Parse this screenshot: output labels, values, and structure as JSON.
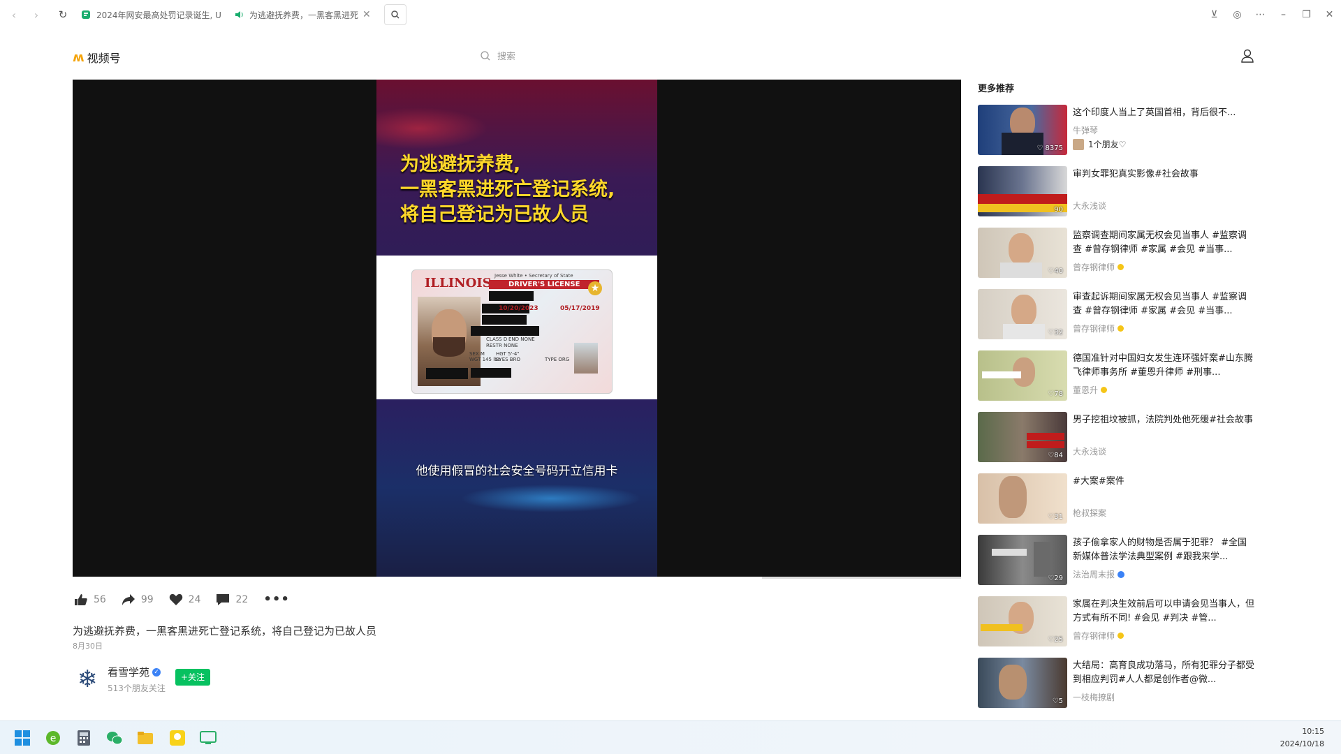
{
  "browser": {
    "tabs": [
      {
        "label": "2024年网安最高处罚记录诞生, U"
      },
      {
        "label": "为逃避抚养费，一黑客黑进死"
      }
    ]
  },
  "app": {
    "logo_text": "视频号",
    "search_placeholder": "搜索"
  },
  "video": {
    "headline": [
      "为逃避抚养费,",
      "一黑客黑进死亡登记系统,",
      "将自己登记为已故人员"
    ],
    "subtitle": "他使用假冒的社会安全号码开立信用卡",
    "card": {
      "state": "ILLINOIS",
      "type": "DRIVER'S LICENSE",
      "secretary": "Jesse White • Secretary of State",
      "issue_date": "10/20/2023",
      "exp_date": "05/17/2019",
      "class": "D",
      "restr": "NONE",
      "end": "NONE",
      "sex": "M",
      "height": "5'-4\"",
      "weight": "145 lbs",
      "eyes": "BRO",
      "type_code": "ORG"
    }
  },
  "actions": {
    "like": "56",
    "share": "99",
    "favorite": "24",
    "comment": "22"
  },
  "post": {
    "description": "为逃避抚养费，一黑客黑进死亡登记系统，将自己登记为已故人员",
    "date": "8月30日",
    "author": "看雪学苑",
    "fans": "513个朋友关注",
    "follow_label": "+关注"
  },
  "recommend": {
    "title": "更多推荐",
    "items": [
      {
        "title": "这个印度人当上了英国首相，背后很不...",
        "author": "牛弹琴",
        "likes": "8375",
        "friends": "1个朋友♡"
      },
      {
        "title": "审判女罪犯真实影像#社会故事",
        "author": "大永浅谈",
        "likes": "90"
      },
      {
        "title": "监察调查期间家属无权会见当事人 #监察调查 #曾存钢律师 #家属 #会见 #当事...",
        "author": "曾存钢律师",
        "likes": "40"
      },
      {
        "title": "审查起诉期间家属无权会见当事人 #监察调查 #曾存钢律师 #家属 #会见 #当事...",
        "author": "曾存钢律师",
        "likes": "32"
      },
      {
        "title": "德国准针对中国妇女发生连环强奸案#山东腾飞律师事务所 #董恩升律师 #刑事...",
        "author": "董恩升",
        "likes": "78"
      },
      {
        "title": "男子挖祖坟被抓，法院判处他死缓#社会故事",
        "author": "大永浅谈",
        "likes": "84"
      },
      {
        "title": "#大案#案件",
        "author": "枪叔探案",
        "likes": "31"
      },
      {
        "title": "孩子偷拿家人的财物是否属于犯罪？ #全国新媒体普法学法典型案例 #跟我来学...",
        "author": "法治周末报",
        "likes": "29"
      },
      {
        "title": "家属在判决生效前后可以申请会见当事人，但方式有所不同! #会见 #判决 #管...",
        "author": "曾存钢律师",
        "likes": "25"
      },
      {
        "title": "大结局：高育良成功落马，所有犯罪分子都受到相应判罚#人人都是创作者@微...",
        "author": "一枝梅撩剧",
        "likes": "5"
      }
    ]
  },
  "taskbar": {
    "time": "10:15",
    "date": "2024/10/18"
  }
}
